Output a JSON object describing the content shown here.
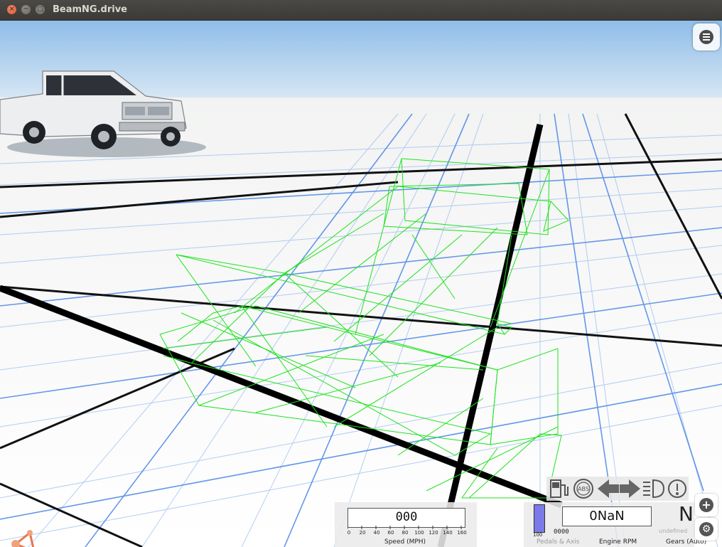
{
  "window": {
    "title": "BeamNG.drive",
    "close_glyph": "×",
    "minimize_glyph": "−",
    "maximize_glyph": "□"
  },
  "hud": {
    "speedometer": {
      "value": "000",
      "label": "Speed (MPH)",
      "ticks": [
        "0",
        "20",
        "40",
        "60",
        "80",
        "100",
        "120",
        "140",
        "160"
      ]
    },
    "pedals": {
      "label": "Pedals & Axis",
      "scale_label": "100",
      "counter": "0000"
    },
    "engine_rpm": {
      "value": "0NaN",
      "label": "Engine RPM"
    },
    "gears": {
      "value": "N",
      "sub_value": "undefined",
      "label": "Gears (Auto)"
    },
    "side_buttons": {
      "add_glyph": "+",
      "settings_glyph": "⚙"
    }
  },
  "icons": [
    "menu-icon",
    "fuel-pump-icon",
    "abs-icon",
    "left-arrow-icon",
    "right-arrow-icon",
    "headlight-icon",
    "warning-icon",
    "plus-icon",
    "gear-icon",
    "beamng-logo-icon"
  ],
  "colors": {
    "wireframe": "#1ee21e",
    "grid_blue": "#3f7fe6",
    "sky_top": "#8fbde8",
    "pedal_fill": "#7a7ae8"
  }
}
